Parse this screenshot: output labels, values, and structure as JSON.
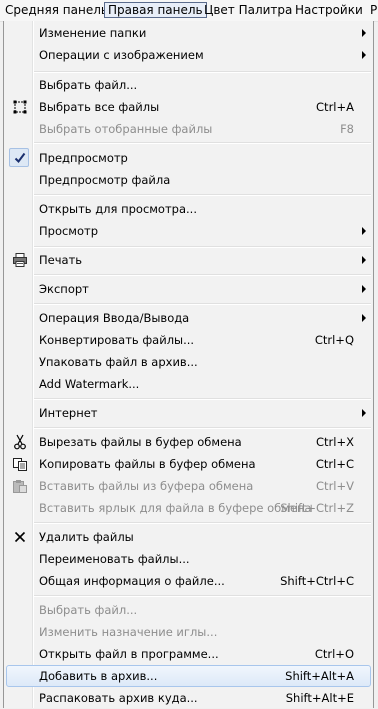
{
  "menubar": {
    "items": [
      {
        "label": "Средняя панель"
      },
      {
        "label": "Правая панель"
      },
      {
        "label": "Цвет Палитра"
      },
      {
        "label": "Настройки"
      },
      {
        "label": "Р"
      }
    ]
  },
  "menu": {
    "items": [
      {
        "label": "Изменение папки",
        "shortcut": "",
        "submenu": true
      },
      {
        "label": "Операции с изображением",
        "shortcut": "",
        "submenu": true
      },
      {
        "label": "Выбрать файл...",
        "shortcut": ""
      },
      {
        "label": "Выбрать все файлы",
        "shortcut": "Ctrl+A",
        "icon": "select-all-icon"
      },
      {
        "label": "Выбрать отобранные файлы",
        "shortcut": "F8",
        "disabled": true
      },
      {
        "label": "Предпросмотр",
        "shortcut": "",
        "icon": "checkmark-icon",
        "checked": true
      },
      {
        "label": "Предпросмотр файла",
        "shortcut": ""
      },
      {
        "label": "Открыть для просмотра...",
        "shortcut": ""
      },
      {
        "label": "Просмотр",
        "shortcut": "",
        "submenu": true
      },
      {
        "label": "Печать",
        "shortcut": "",
        "submenu": true,
        "icon": "printer-icon"
      },
      {
        "label": "Экспорт",
        "shortcut": "",
        "submenu": true
      },
      {
        "label": "Операция Ввода/Вывода",
        "shortcut": "",
        "submenu": true
      },
      {
        "label": "Конвертировать файлы...",
        "shortcut": "Ctrl+Q"
      },
      {
        "label": "Упаковать файл в архив...",
        "shortcut": ""
      },
      {
        "label": "Add Watermark...",
        "shortcut": ""
      },
      {
        "label": "Интернет",
        "shortcut": "",
        "submenu": true
      },
      {
        "label": "Вырезать файлы в буфер обмена",
        "shortcut": "Ctrl+X",
        "icon": "scissors-icon"
      },
      {
        "label": "Копировать файлы в буфер обмена",
        "shortcut": "Ctrl+C",
        "icon": "copy-icon"
      },
      {
        "label": "Вставить файлы из буфера обмена",
        "shortcut": "Ctrl+V",
        "icon": "paste-icon",
        "disabled": true
      },
      {
        "label": "Вставить ярлык для файла в буфере обмена",
        "shortcut": "Shift+Ctrl+Z",
        "disabled": true
      },
      {
        "label": "Удалить файлы",
        "shortcut": "",
        "icon": "delete-icon"
      },
      {
        "label": "Переименовать файлы...",
        "shortcut": ""
      },
      {
        "label": "Общая информация о файле...",
        "shortcut": "Shift+Ctrl+C"
      },
      {
        "label": "Выбрать файл...",
        "shortcut": "",
        "disabled": true
      },
      {
        "label": "Изменить назначение иглы...",
        "shortcut": "",
        "disabled": true
      },
      {
        "label": "Открыть файл в программе...",
        "shortcut": "Ctrl+O"
      },
      {
        "label": "Добавить в архив...",
        "shortcut": "Shift+Alt+A",
        "highlighted": true
      },
      {
        "label": "Распаковать архив куда...",
        "shortcut": "Shift+Alt+E"
      }
    ]
  }
}
